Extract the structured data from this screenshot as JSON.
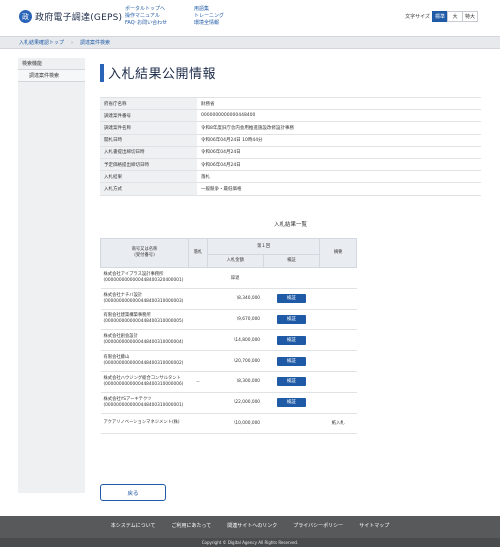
{
  "header": {
    "logo_mark": "政",
    "logo_text": "政府電子調達(GEPS)",
    "links_col1": [
      "ポータルトップへ",
      "操作マニュアル",
      "FAQ･お問い合わせ"
    ],
    "links_col2": [
      "用語集",
      "トレーニング",
      "環境全情報"
    ],
    "font_size_label": "文字サイズ",
    "font_sizes": [
      "標準",
      "大",
      "特大"
    ],
    "font_size_active": "標準"
  },
  "breadcrumb": [
    "入札結果確認トップ",
    "調達案件検索"
  ],
  "sidebar": {
    "items": [
      "検索機能",
      "調達案件検索"
    ]
  },
  "page_title": "入札結果公開情報",
  "info": [
    {
      "key": "府省庁名称",
      "value": "財務省"
    },
    {
      "key": "調達案件番号",
      "value": "0000000000000448400"
    },
    {
      "key": "調達案件名称",
      "value": "令和8年度旧庁舎内会用推進施設改修設計事務"
    },
    {
      "key": "開札日時",
      "value": "令和06年04月24日 10時44分"
    },
    {
      "key": "入札書提出締切日時",
      "value": "令和06年04月24日"
    },
    {
      "key": "予定価格提出締切日時",
      "value": "令和06年04月24日"
    },
    {
      "key": "入札結果",
      "value": "落札"
    },
    {
      "key": "入札方式",
      "value": "一般競争・最低価格"
    }
  ],
  "results": {
    "title": "入札結果一覧",
    "col_name": "商号又は名称\n(受付番号)",
    "col_award": "落札",
    "col_round": "第１回",
    "col_amount": "入札金額",
    "col_verify": "検証",
    "col_note": "摘要",
    "verify_label": "検証",
    "rows": [
      {
        "name": "株式会社アイプラス設計事務所",
        "num": "(0000000000000448400320400001)",
        "award": "",
        "amount": "辞退",
        "verify": false,
        "note": ""
      },
      {
        "name": "株式会社ナチバ設計",
        "num": "(0000000000000448400310000003)",
        "award": "",
        "amount": "\\8,340,000",
        "verify": true,
        "note": ""
      },
      {
        "name": "有限会社建築構築事務所",
        "num": "(0000000000000448400310000005)",
        "award": "",
        "amount": "\\9,670,000",
        "verify": true,
        "note": ""
      },
      {
        "name": "株式会社創会設計",
        "num": "(0000000000000448400310000004)",
        "award": "",
        "amount": "\\14,800,000",
        "verify": true,
        "note": ""
      },
      {
        "name": "有限会社藤山",
        "num": "(0000000000000448400310000002)",
        "award": "",
        "amount": "\\20,700,000",
        "verify": true,
        "note": ""
      },
      {
        "name": "株式会社ハウジング総合コンサルタント",
        "num": "(0000000000000448400310000006)",
        "award": "－",
        "amount": "\\8,300,000",
        "verify": true,
        "note": ""
      },
      {
        "name": "株式会社YSアーキテクツ",
        "num": "(0000000000000448400310000001)",
        "award": "",
        "amount": "\\22,000,000",
        "verify": true,
        "note": ""
      },
      {
        "name": "アクアリノベーションマネジメント(株)",
        "num": "",
        "award": "",
        "amount": "\\10,000,000",
        "verify": false,
        "note": "紙入札"
      }
    ]
  },
  "back_button": "戻る",
  "footer": {
    "links": [
      "本システムについて",
      "ご利用にあたって",
      "関連サイトへのリンク",
      "プライバシーポリシー",
      "サイトマップ"
    ],
    "copyright": "Copyright © Digital Agency All Rights Reserved."
  }
}
